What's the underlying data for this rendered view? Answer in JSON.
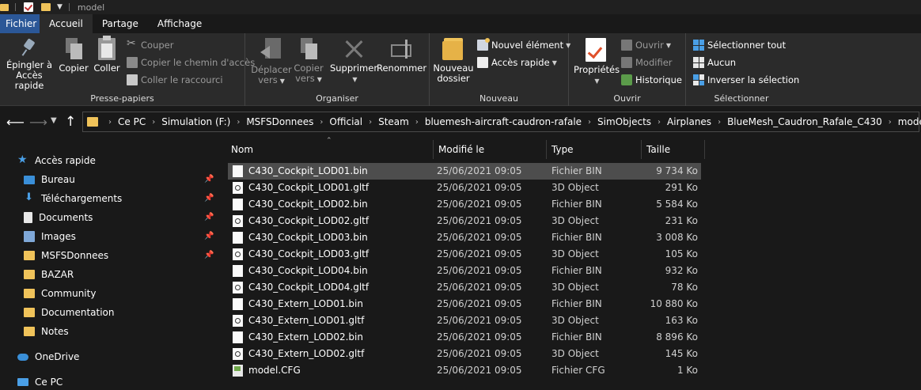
{
  "window": {
    "title": "model"
  },
  "tabs": [
    "Fichier",
    "Accueil",
    "Partage",
    "Affichage"
  ],
  "ribbon": {
    "clipboard": {
      "label": "Presse-papiers",
      "pin": "Épingler à\nAccès rapide",
      "pin_l1": "Épingler à",
      "pin_l2": "Accès rapide",
      "copy": "Copier",
      "paste": "Coller",
      "cut": "Couper",
      "copy_path": "Copier le chemin d'accès",
      "paste_shortcut": "Coller le raccourci"
    },
    "organize": {
      "label": "Organiser",
      "move_l1": "Déplacer",
      "move_l2": "vers",
      "copyto_l1": "Copier",
      "copyto_l2": "vers",
      "delete": "Supprimer",
      "rename": "Renommer"
    },
    "new": {
      "label": "Nouveau",
      "folder_l1": "Nouveau",
      "folder_l2": "dossier",
      "new_item": "Nouvel élément",
      "easy_access": "Accès rapide"
    },
    "open": {
      "label": "Ouvrir",
      "properties": "Propriétés",
      "open": "Ouvrir",
      "edit": "Modifier",
      "history": "Historique"
    },
    "select": {
      "label": "Sélectionner",
      "select_all": "Sélectionner tout",
      "select_none": "Aucun",
      "invert": "Inverser la sélection"
    }
  },
  "address": {
    "crumbs": [
      "Ce PC",
      "Simulation (F:)",
      "MSFSDonnees",
      "Official",
      "Steam",
      "bluemesh-aircraft-caudron-rafale",
      "SimObjects",
      "Airplanes",
      "BlueMesh_Caudron_Rafale_C430",
      "model"
    ]
  },
  "navpane": {
    "quick_access": "Accès rapide",
    "items": [
      "Bureau",
      "Téléchargements",
      "Documents",
      "Images",
      "MSFSDonnees",
      "BAZAR",
      "Community",
      "Documentation",
      "Notes"
    ],
    "onedrive": "OneDrive",
    "thispc": "Ce PC"
  },
  "columns": {
    "name": "Nom",
    "modified": "Modifié le",
    "type": "Type",
    "size": "Taille"
  },
  "files": [
    {
      "name": "C430_Cockpit_LOD01.bin",
      "date": "25/06/2021 09:05",
      "type": "Fichier BIN",
      "size": "9 734 Ko"
    },
    {
      "name": "C430_Cockpit_LOD01.gltf",
      "date": "25/06/2021 09:05",
      "type": "3D Object",
      "size": "291 Ko"
    },
    {
      "name": "C430_Cockpit_LOD02.bin",
      "date": "25/06/2021 09:05",
      "type": "Fichier BIN",
      "size": "5 584 Ko"
    },
    {
      "name": "C430_Cockpit_LOD02.gltf",
      "date": "25/06/2021 09:05",
      "type": "3D Object",
      "size": "231 Ko"
    },
    {
      "name": "C430_Cockpit_LOD03.bin",
      "date": "25/06/2021 09:05",
      "type": "Fichier BIN",
      "size": "3 008 Ko"
    },
    {
      "name": "C430_Cockpit_LOD03.gltf",
      "date": "25/06/2021 09:05",
      "type": "3D Object",
      "size": "105 Ko"
    },
    {
      "name": "C430_Cockpit_LOD04.bin",
      "date": "25/06/2021 09:05",
      "type": "Fichier BIN",
      "size": "932 Ko"
    },
    {
      "name": "C430_Cockpit_LOD04.gltf",
      "date": "25/06/2021 09:05",
      "type": "3D Object",
      "size": "78 Ko"
    },
    {
      "name": "C430_Extern_LOD01.bin",
      "date": "25/06/2021 09:05",
      "type": "Fichier BIN",
      "size": "10 880 Ko"
    },
    {
      "name": "C430_Extern_LOD01.gltf",
      "date": "25/06/2021 09:05",
      "type": "3D Object",
      "size": "163 Ko"
    },
    {
      "name": "C430_Extern_LOD02.bin",
      "date": "25/06/2021 09:05",
      "type": "Fichier BIN",
      "size": "8 896 Ko"
    },
    {
      "name": "C430_Extern_LOD02.gltf",
      "date": "25/06/2021 09:05",
      "type": "3D Object",
      "size": "145 Ko"
    },
    {
      "name": "model.CFG",
      "date": "25/06/2021 09:05",
      "type": "Fichier CFG",
      "size": "1 Ko"
    }
  ]
}
